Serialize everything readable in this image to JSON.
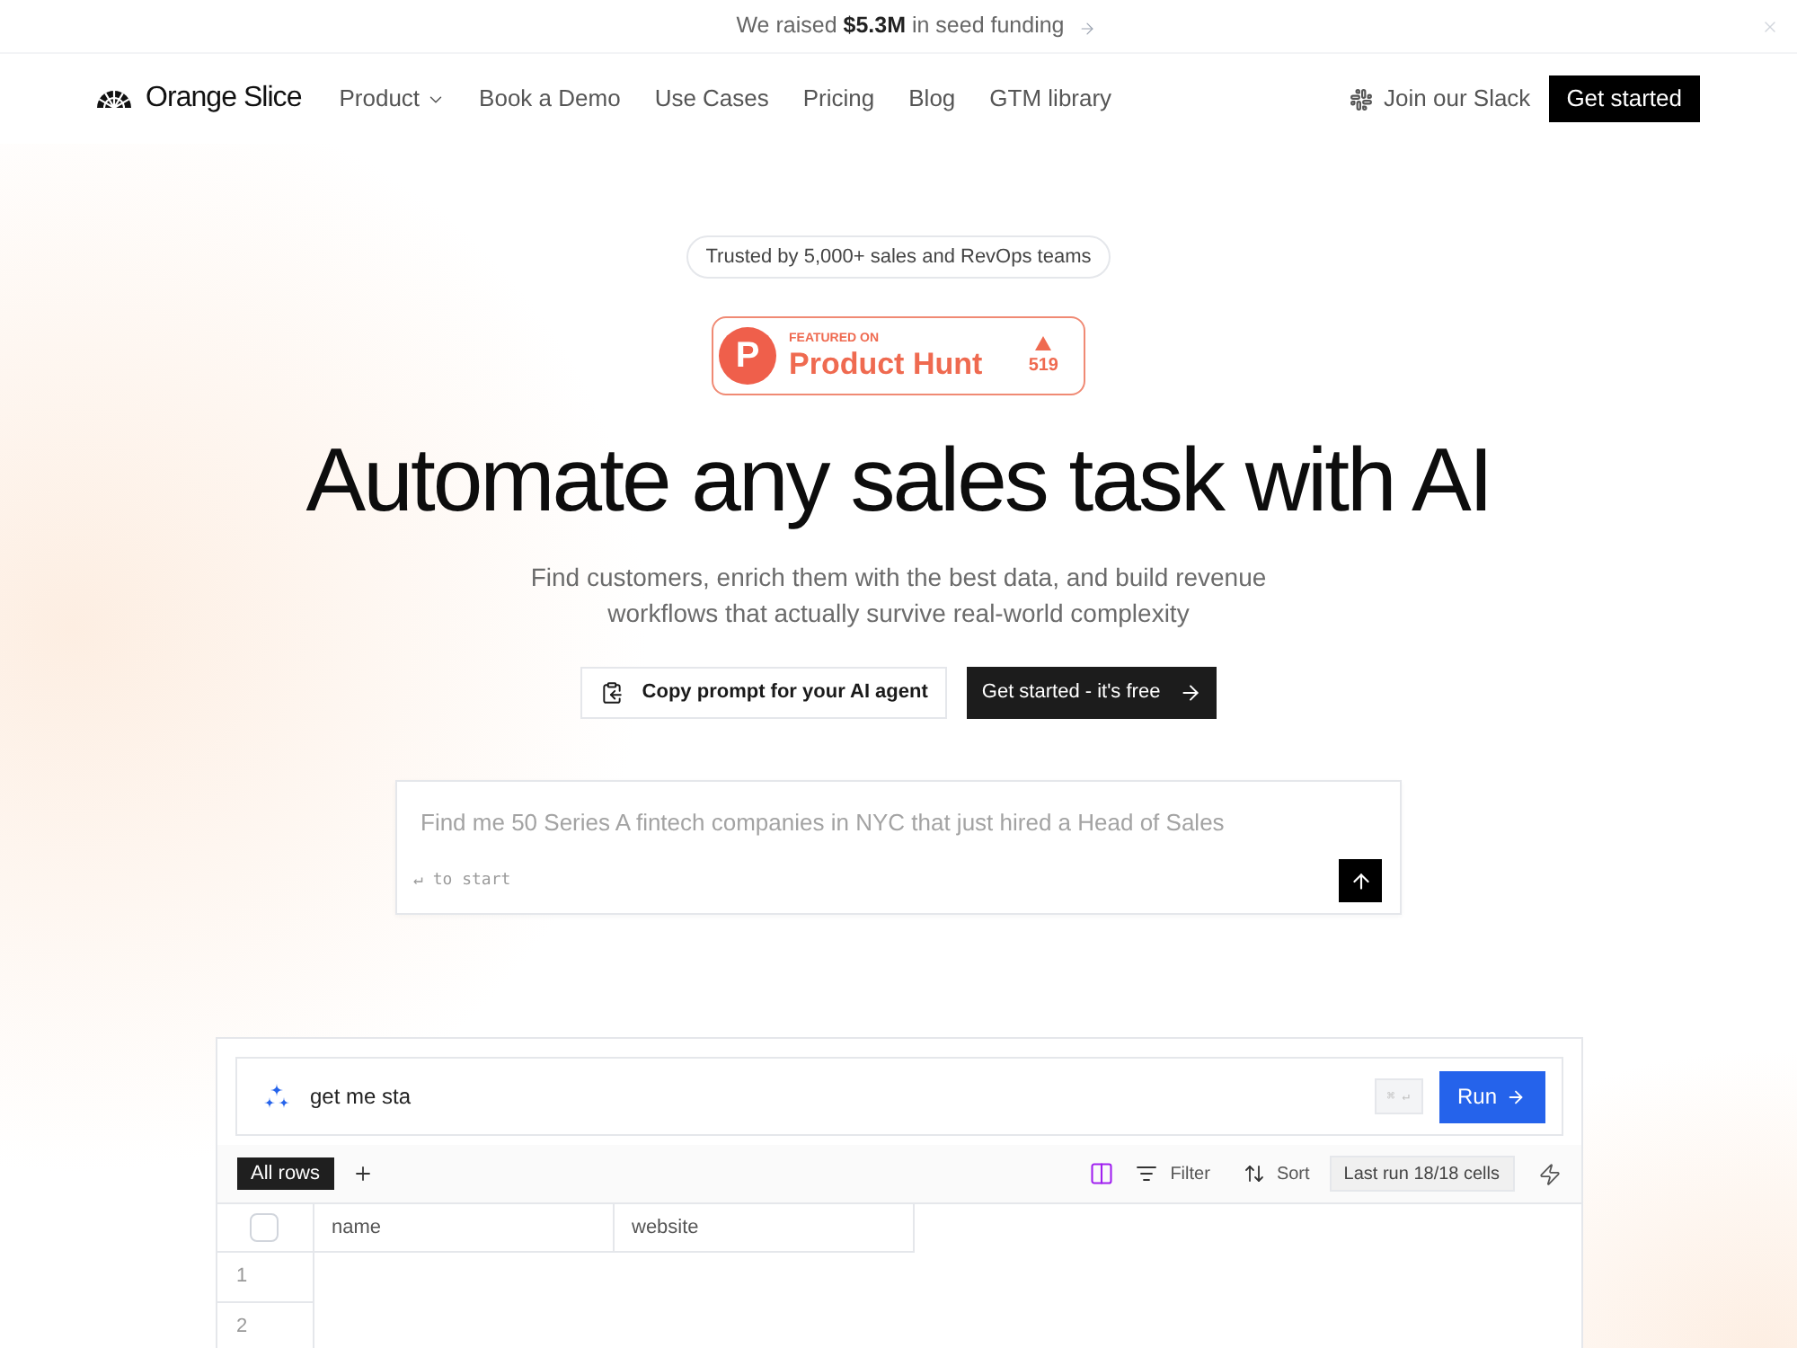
{
  "banner": {
    "text": "We raised **$5.3M** in seed funding"
  },
  "nav": {
    "brand": "Orange Slice",
    "items": [
      {
        "label": "Product",
        "kind": "menu"
      },
      {
        "label": "Book a Demo",
        "kind": "link"
      },
      {
        "label": "Use Cases",
        "kind": "link"
      },
      {
        "label": "Pricing",
        "kind": "link"
      },
      {
        "label": "Blog",
        "kind": "link"
      },
      {
        "label": "GTM library",
        "kind": "link"
      }
    ],
    "community_link": "Join our Slack",
    "cta": "Get started"
  },
  "hero": {
    "trust_badge": "Trusted by 5,000+ sales and RevOps teams",
    "product_hunt": {
      "logo_letter": "P",
      "eyebrow": "FEATURED ON",
      "name": "Product Hunt",
      "votes": "519"
    },
    "title": "Automate any sales task with AI",
    "subtitle": [
      "Find customers, enrich them with the best data, and build revenue",
      "workflows that actually survive real-world complexity"
    ],
    "buttons": [
      {
        "label": "Copy prompt for your AI agent",
        "kind": "secondary"
      },
      {
        "label": "Get started - it's free",
        "kind": "primary"
      }
    ]
  },
  "prompt_box": {
    "placeholder": "Find me 50 Series A fintech companies in NYC that just hired a Head of Sales",
    "hint": "↵ to start"
  },
  "demo": {
    "command": {
      "value": "get me sta",
      "shortcut": "⌘ ↵",
      "button": "Run"
    },
    "views": [
      {
        "label": "All rows",
        "selected": true
      }
    ],
    "filter_button": "Filter",
    "sort_button": "Sort",
    "run_status": "Last run 18/18 cells",
    "table": {
      "select_all": {
        "checked": false
      },
      "columns": [
        "name",
        "website"
      ],
      "rows": [
        "1",
        "2"
      ]
    }
  }
}
